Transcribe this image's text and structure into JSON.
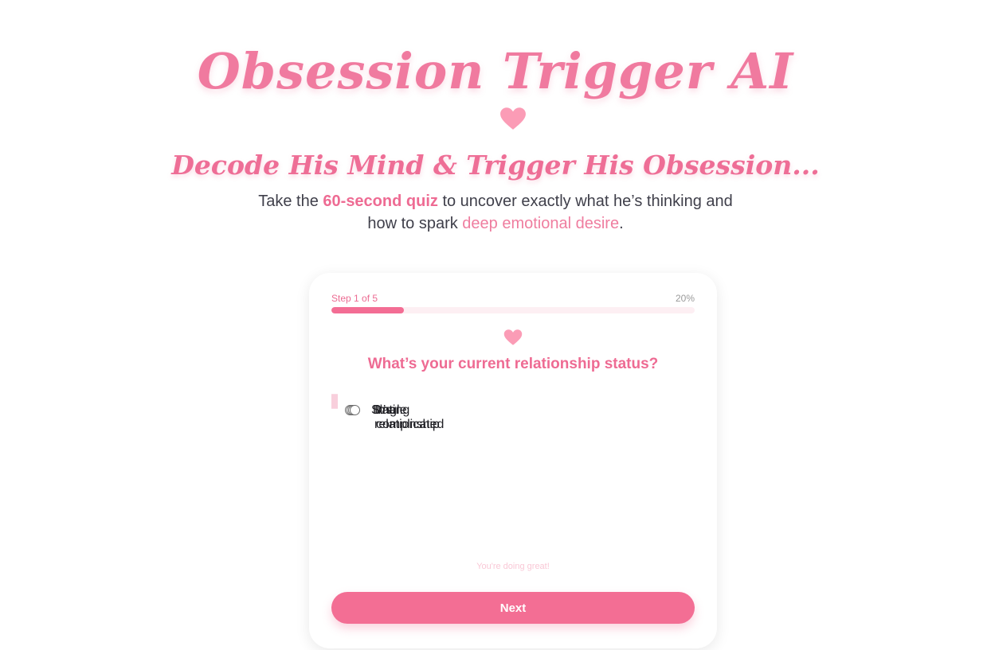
{
  "hero": {
    "title": "Obsession Trigger AI",
    "tagline": "Decode His Mind & Trigger His Obsession...",
    "subtitle": {
      "part1": "Take the ",
      "highlight": "60-second quiz",
      "part2": " to uncover exactly what he’s thinking and how to spark ",
      "accent": "deep emotional desire",
      "part3": "."
    },
    "heart_icon": "heart-icon"
  },
  "quiz": {
    "step_label": "Step 1 of 5",
    "percent_label": "20%",
    "progress_fraction": 0.2,
    "question_icon": "heart-icon",
    "question": "What’s your current relationship status?",
    "options": [
      {
        "label": "Single"
      },
      {
        "label": "Dating"
      },
      {
        "label": "In a relationship"
      },
      {
        "label": "It’s complicated"
      }
    ],
    "encouragement": "You're doing great!",
    "next_label": "Next"
  },
  "colors": {
    "brand_pink": "#f36e94",
    "heart_pink": "#fb9cb6",
    "option_border": "#f8cfdc"
  }
}
